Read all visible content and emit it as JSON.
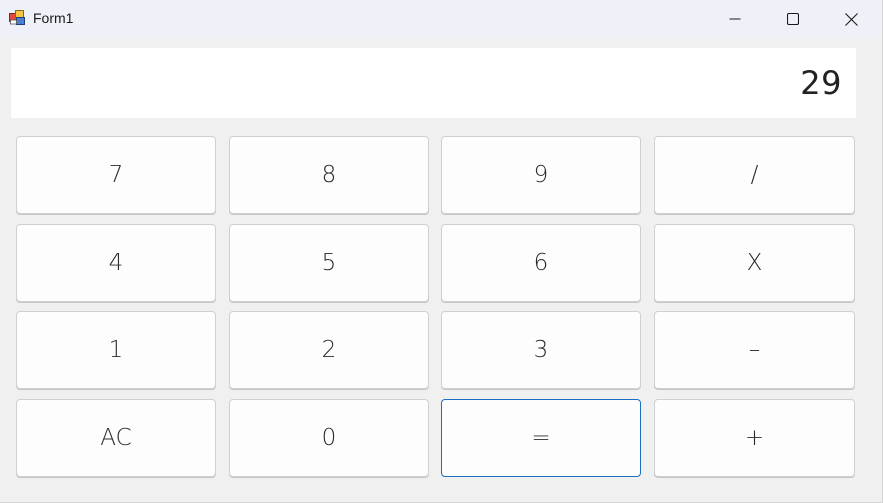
{
  "window": {
    "title": "Form1",
    "app_icon": "winforms-app-icon",
    "controls": {
      "minimize_icon": "minimize-icon",
      "maximize_icon": "maximize-icon",
      "close_icon": "close-icon"
    }
  },
  "display": {
    "value": "29"
  },
  "keys": {
    "row0": [
      "7",
      "8",
      "9",
      "/"
    ],
    "row1": [
      "4",
      "5",
      "6",
      "X"
    ],
    "row2": [
      "1",
      "2",
      "3",
      "–"
    ],
    "row3": [
      "AC",
      "0",
      "=",
      "+"
    ]
  },
  "focused_key": "=",
  "colors": {
    "titlebar": "#eef1f8",
    "window_bg": "#f0f0f0",
    "display_bg": "#ffffff",
    "key_bg": "#fdfdfd",
    "focus_border": "#1a6fc9"
  }
}
